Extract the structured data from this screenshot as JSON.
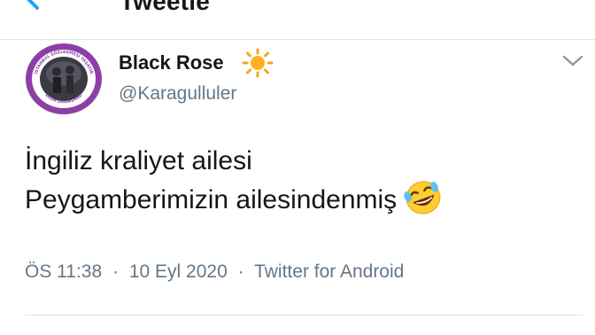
{
  "header": {
    "title": "Tweetle",
    "back_icon": "back-arrow-icon"
  },
  "tweet": {
    "author": {
      "display_name": "Black Rose",
      "name_emoji": "sun-icon",
      "handle": "@Karagulluler",
      "avatar_icon": "avatar",
      "avatar_ring_text": "İSTANBUL SÖZLEŞMESİ YAŞATIR",
      "avatar_bottom_text": "KADIN DAYANIŞMASI"
    },
    "menu_icon": "chevron-down-icon",
    "text_lines": [
      "İngiliz kraliyet ailesi",
      "Peygamberimizin ailesindenmiş"
    ],
    "text_emoji": "rolling-on-floor-laughing-icon",
    "time": "ÖS 11:38",
    "date": "10 Eyl 2020",
    "source": "Twitter for Android",
    "separator": "·"
  },
  "colors": {
    "text_primary": "#14171a",
    "text_secondary": "#657786",
    "accent": "#1da1f2",
    "avatar_ring": "#8e3fa6",
    "divider": "#dfe5ea"
  }
}
